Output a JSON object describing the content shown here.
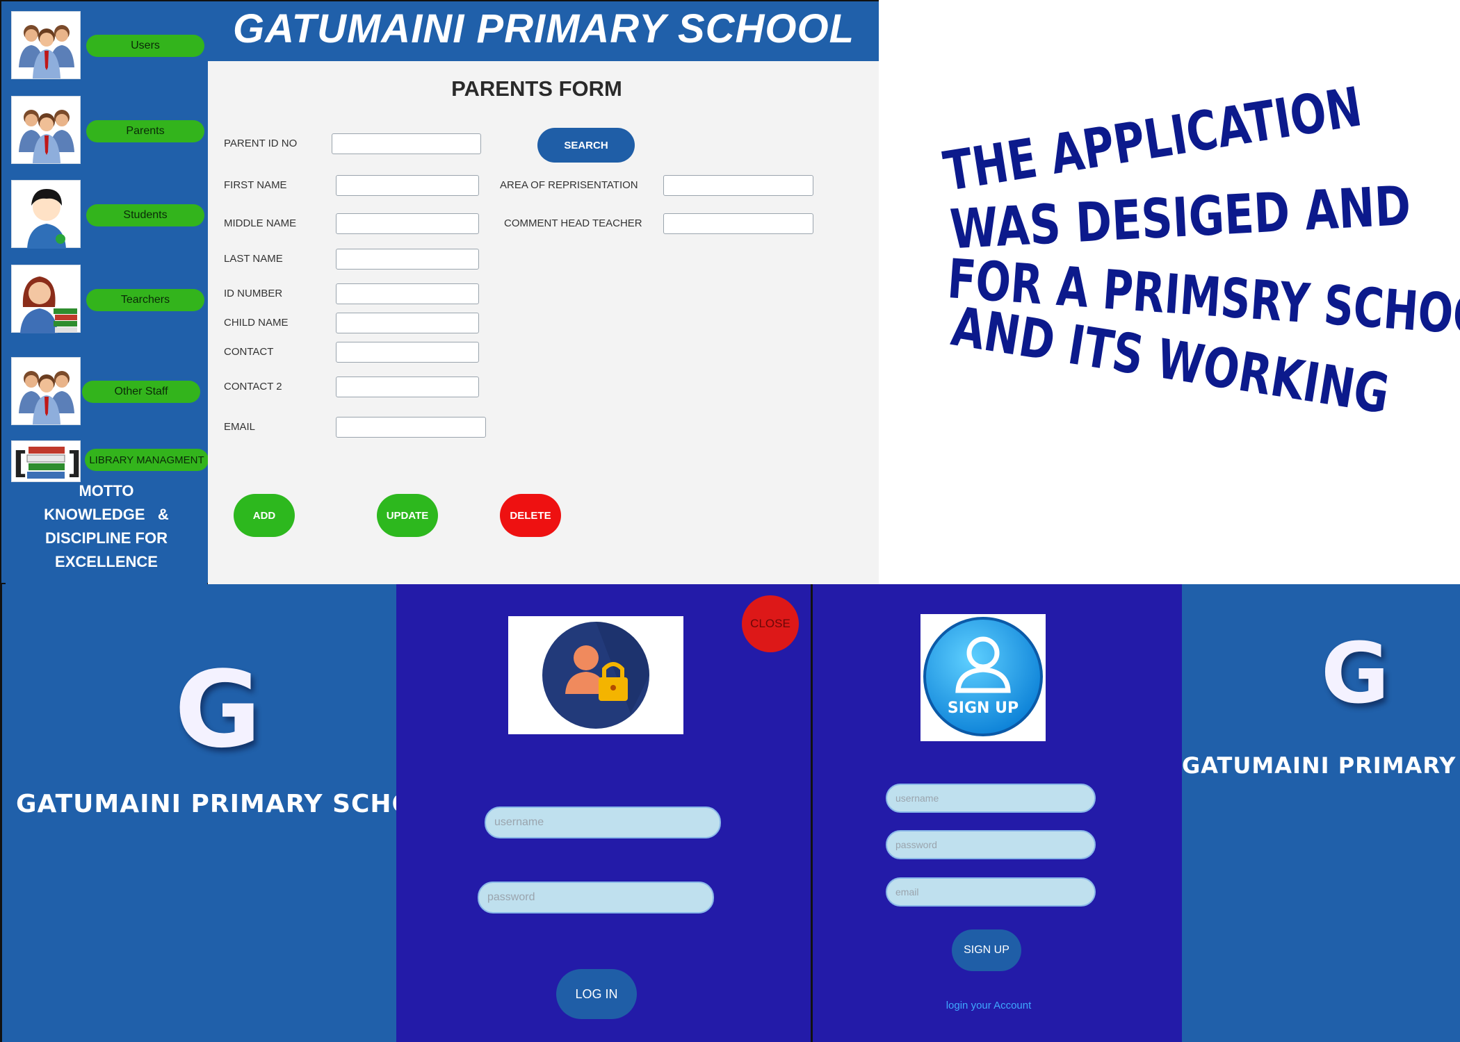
{
  "colors": {
    "sidebar_blue": "#2060aa",
    "nav_green": "#33b41c",
    "delete_red": "#ee1111",
    "login_panel": "#231ba8",
    "warp_text": "#0c1a8c"
  },
  "sidebar": {
    "items": [
      {
        "label": "Users",
        "icon": "users-group-icon"
      },
      {
        "label": "Parents",
        "icon": "parents-group-icon"
      },
      {
        "label": "Students",
        "icon": "student-avatar-icon"
      },
      {
        "label": "Tearchers",
        "icon": "teacher-books-icon"
      },
      {
        "label": "Other Staff",
        "icon": "staff-group-icon"
      },
      {
        "label": "LIBRARY MANAGMENT",
        "icon": "library-books-icon"
      }
    ],
    "motto_lines": [
      "MOTTO",
      "KNOWLEDGE   &",
      "DISCIPLINE FOR",
      "EXCELLENCE"
    ]
  },
  "header": {
    "title": "GATUMAINI PRIMARY SCHOOL"
  },
  "form": {
    "title": "PARENTS FORM",
    "parent_id_label": "PARENT ID NO",
    "search_label": "SEARCH",
    "fields_left": [
      "FIRST NAME",
      "MIDDLE NAME",
      "LAST NAME",
      "ID NUMBER",
      "CHILD NAME",
      "CONTACT",
      "CONTACT 2",
      "EMAIL"
    ],
    "fields_right": [
      "AREA OF REPRISENTATION",
      "COMMENT HEAD TEACHER"
    ],
    "buttons": {
      "add": "ADD",
      "update": "UPDATE",
      "delete": "DELETE"
    }
  },
  "warp_text": {
    "lines": [
      "THE APPLICATION",
      "WAS DESIGED AND",
      "FOR A PRIMSRY SCHOOL",
      "AND ITS WORKING"
    ]
  },
  "login": {
    "logo_letter": "G",
    "school_name": "GATUMAINI PRIMARY SCHOOL",
    "close_label": "CLOSE",
    "username_placeholder": "username",
    "password_placeholder": "password",
    "login_button": "LOG IN",
    "icon": "user-lock-icon"
  },
  "signup": {
    "badge_text": "SIGN UP",
    "username_placeholder": "username",
    "password_placeholder": "password",
    "email_placeholder": "email",
    "signup_button": "SIGN UP",
    "login_link": "login your Account",
    "logo_letter": "G",
    "school_name": "GATUMAINI PRIMARY SCHOOL"
  }
}
